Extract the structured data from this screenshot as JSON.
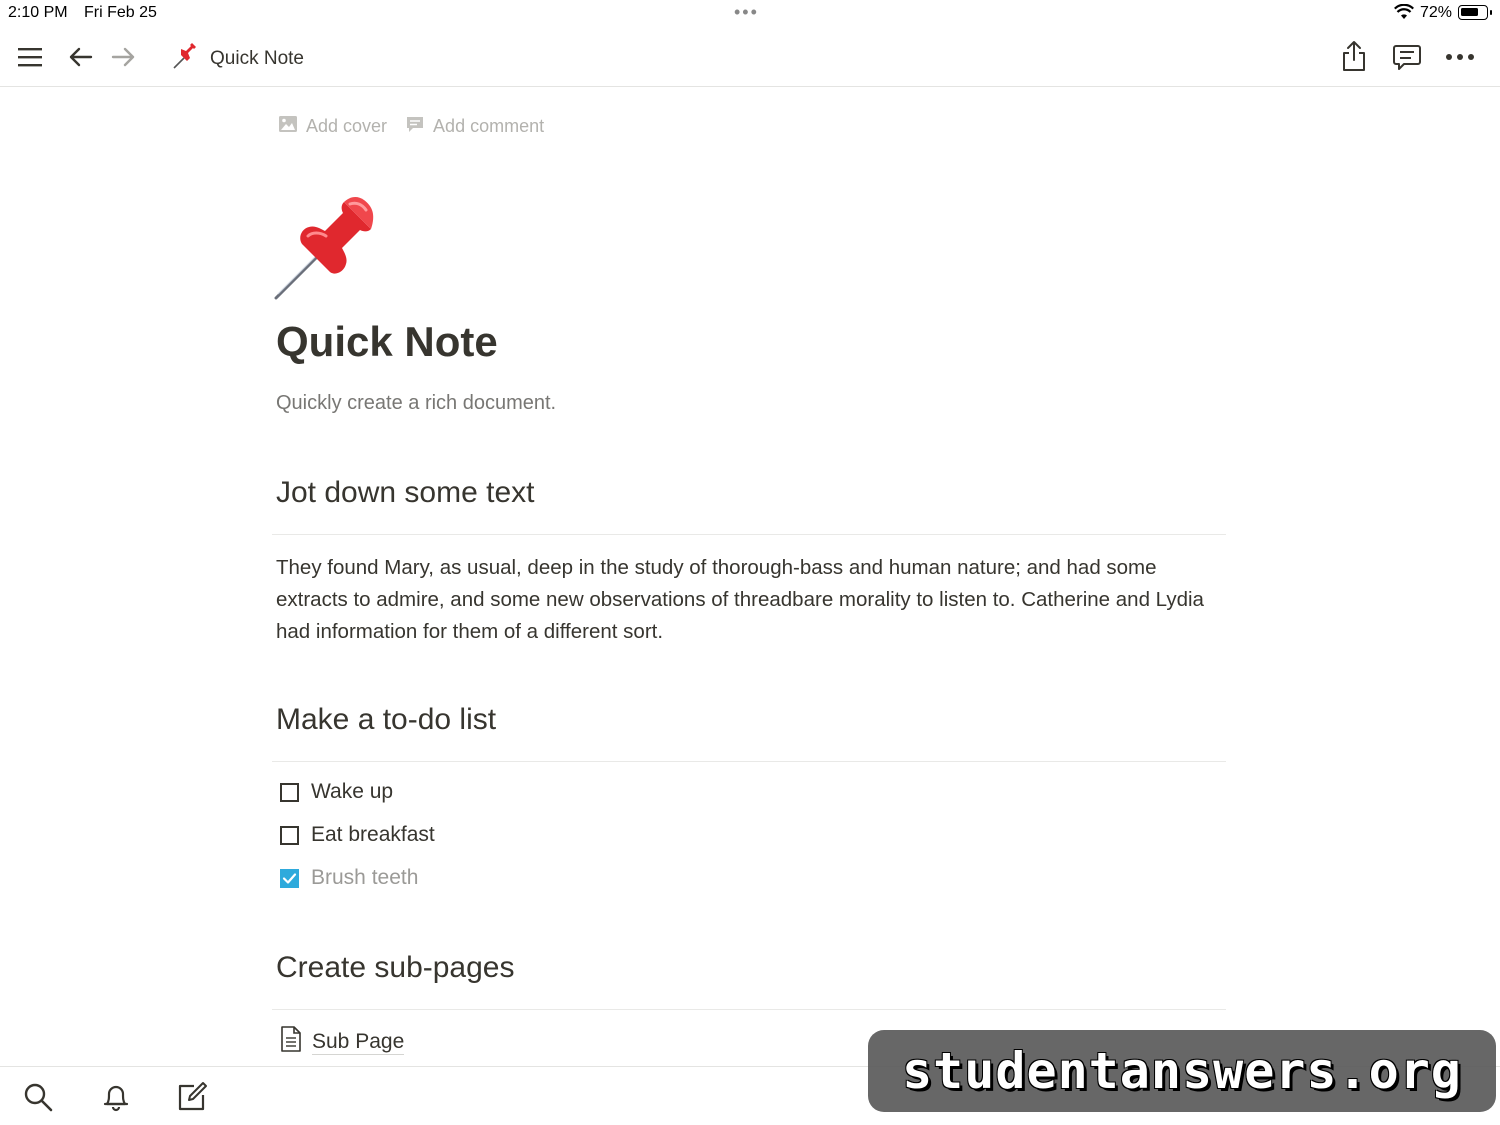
{
  "status_bar": {
    "time": "2:10 PM",
    "date": "Fri Feb 25",
    "multitask_dots": "•••",
    "battery_percent": "72%",
    "battery_level": 0.72
  },
  "topbar": {
    "page_title": "Quick Note",
    "icons": [
      "menu-icon",
      "back-arrow-icon",
      "forward-arrow-icon",
      "pushpin-icon",
      "share-icon",
      "comment-icon",
      "more-icon"
    ]
  },
  "page_actions": {
    "add_cover": "Add cover",
    "add_comment": "Add comment"
  },
  "page": {
    "title": "Quick Note",
    "subtitle": "Quickly create a rich document."
  },
  "sections": {
    "text": {
      "heading": "Jot down some text",
      "paragraph": "They found Mary, as usual, deep in the study of thorough-bass and human nature; and had some extracts to admire, and some new observations of threadbare morality to listen to. Catherine and Lydia had information for them of a different sort."
    },
    "todo": {
      "heading": "Make a to-do list",
      "items": [
        {
          "label": "Wake up",
          "checked": false
        },
        {
          "label": "Eat breakfast",
          "checked": false
        },
        {
          "label": "Brush teeth",
          "checked": true
        }
      ]
    },
    "subpages": {
      "heading": "Create sub-pages",
      "items": [
        {
          "label": "Sub Page"
        }
      ]
    }
  },
  "bottombar": {
    "icons": [
      "search-icon",
      "bell-icon",
      "compose-icon"
    ]
  },
  "watermark": {
    "text": "studentanswers.org"
  },
  "colors": {
    "text": "#37352f",
    "muted": "#787774",
    "placeholder": "#b3b2ae",
    "checkbox_checked": "#2eaadc",
    "pin_red": "#e0282e"
  }
}
